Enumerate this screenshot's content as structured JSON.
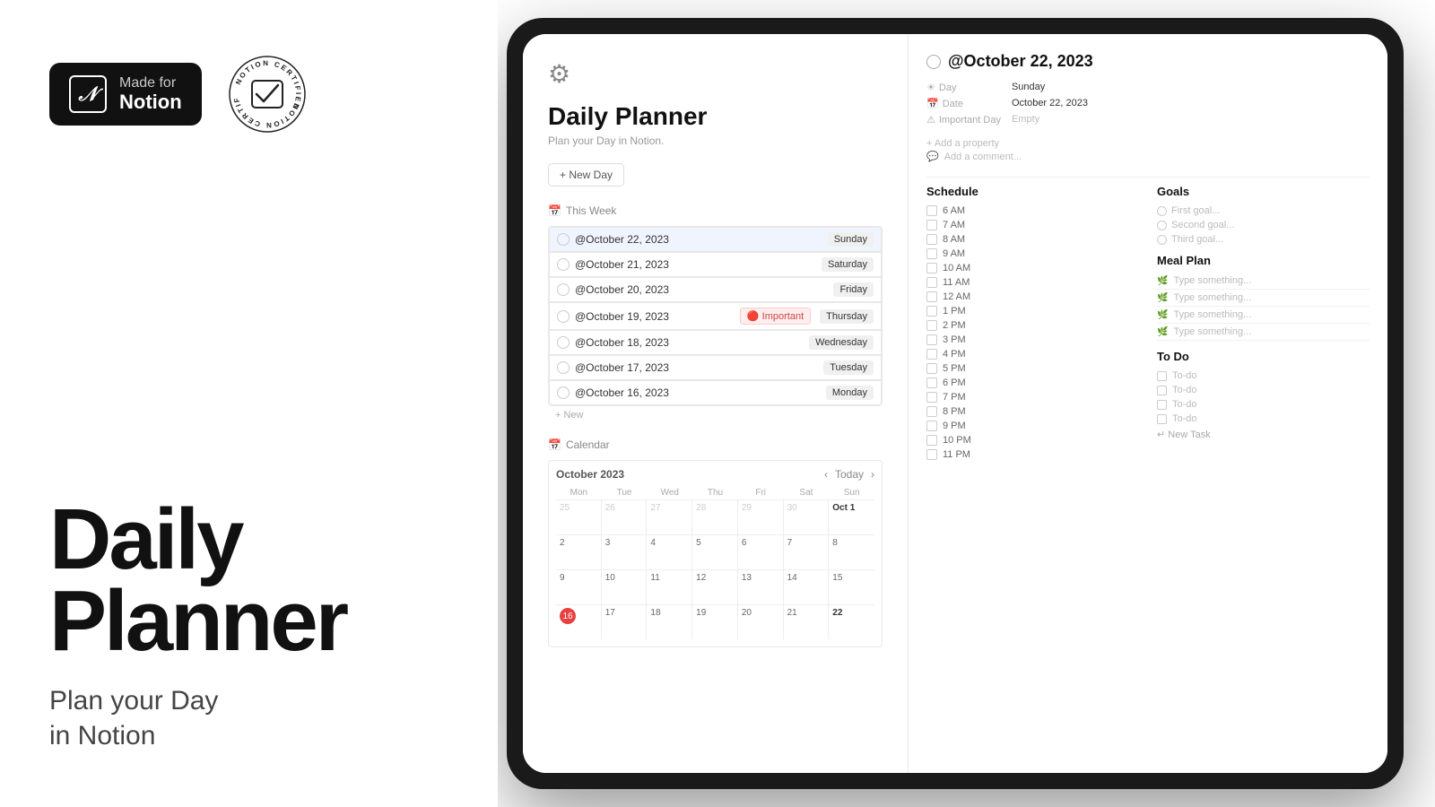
{
  "badges": {
    "notion_badge": {
      "made_for": "Made for",
      "notion": "Notion"
    },
    "certified": "NOTION CERTIFIED"
  },
  "headline": {
    "title_line1": "Daily",
    "title_line2": "Planner",
    "subtitle": "Plan your Day\nin Notion"
  },
  "notion_app": {
    "page_title": "Daily Planner",
    "page_desc": "Plan your Day in Notion.",
    "new_day_btn": "+ New Day",
    "this_week_label": "This Week",
    "calendar_label": "Calendar",
    "calendar_icon": "📅",
    "week_icon": "📅"
  },
  "weeks": [
    {
      "date": "@October 22, 2023",
      "tag": "Sunday",
      "highlighted": true
    },
    {
      "date": "@October 21, 2023",
      "tag": "Saturday"
    },
    {
      "date": "@October 20, 2023",
      "tag": "Friday"
    },
    {
      "date": "@October 19, 2023",
      "tag": "Thursday",
      "important": true
    },
    {
      "date": "@October 18, 2023",
      "tag": "Wednesday"
    },
    {
      "date": "@October 17, 2023",
      "tag": "Tuesday"
    },
    {
      "date": "@October 16, 2023",
      "tag": "Monday"
    }
  ],
  "calendar": {
    "month": "October 2023",
    "today_label": "Today",
    "days": [
      "Mon",
      "Tue",
      "Wed",
      "Thu",
      "Fri",
      "Sat",
      "Sun"
    ],
    "week1": [
      "25",
      "26",
      "27",
      "28",
      "29",
      "30",
      "Oct 1"
    ],
    "week2": [
      "2",
      "3",
      "4",
      "5",
      "6",
      "7",
      "8"
    ],
    "week3": [
      "9",
      "10",
      "11",
      "12",
      "13",
      "14",
      "15"
    ],
    "week4": [
      "16",
      "17",
      "18",
      "19",
      "20",
      "21",
      "22"
    ],
    "today_date": "16"
  },
  "detail": {
    "title": "@October 22, 2023",
    "day_label": "Day",
    "day_value": "Sunday",
    "date_label": "Date",
    "date_value": "October 22, 2023",
    "important_label": "Important Day",
    "important_value": "Empty",
    "add_property": "+ Add a property",
    "add_comment": "Add a comment..."
  },
  "schedule": {
    "header": "Schedule",
    "times": [
      "6 AM",
      "7 AM",
      "8 AM",
      "9 AM",
      "10 AM",
      "11 AM",
      "12 AM",
      "1 PM",
      "2 PM",
      "3 PM",
      "4 PM",
      "5 PM",
      "6 PM",
      "7 PM",
      "8 PM",
      "9 PM",
      "10 PM",
      "11 PM"
    ]
  },
  "goals": {
    "header": "Goals",
    "items": [
      "First goal...",
      "Second goal...",
      "Third goal..."
    ]
  },
  "meal_plan": {
    "header": "Meal Plan",
    "items": [
      "Type something...",
      "Type something...",
      "Type something...",
      "Type something..."
    ]
  },
  "todo": {
    "header": "To Do",
    "items": [
      "To-do",
      "To-do",
      "To-do",
      "To-do"
    ],
    "new_task": "↵ New Task"
  }
}
